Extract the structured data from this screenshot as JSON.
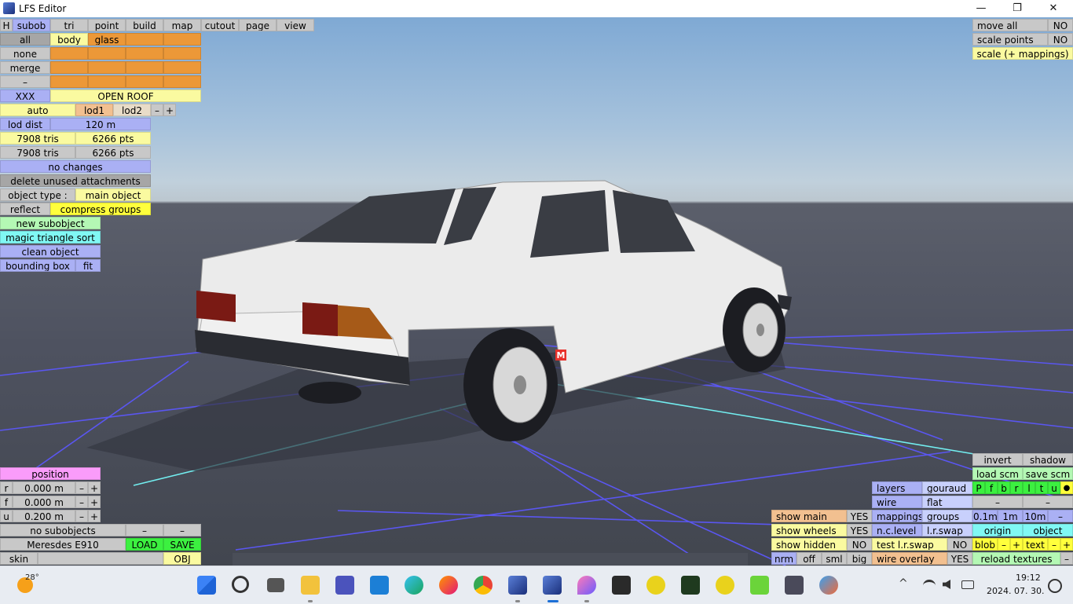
{
  "window": {
    "title": "LFS Editor",
    "min_glyph": "—",
    "max_glyph": "❐",
    "close_glyph": "✕"
  },
  "tabs": [
    "H",
    "subob",
    "tri",
    "point",
    "build",
    "map",
    "cutout",
    "page",
    "view"
  ],
  "left_panel": {
    "all": "all",
    "body": "body",
    "glass": "glass",
    "none": "none",
    "merge": "merge",
    "dash": "–",
    "xxx": "XXX",
    "open_roof": "OPEN ROOF",
    "auto": "auto",
    "lod1": "lod1",
    "lod2": "lod2",
    "minus": "–",
    "plus": "+",
    "lod_dist_label": "lod dist",
    "lod_dist_value": "120 m",
    "tris1": "7908 tris",
    "pts1": "6266 pts",
    "tris2": "7908 tris",
    "pts2": "6266 pts",
    "no_changes": "no changes",
    "delete_unused": "delete unused attachments",
    "object_type_label": "object type :",
    "object_type_value": "main object",
    "reflect": "reflect",
    "compress_groups": "compress groups",
    "new_subobject": "new subobject",
    "magic_triangle_sort": "magic triangle sort",
    "clean_object": "clean object",
    "bounding_box": "bounding box",
    "fit": "fit"
  },
  "top_right": {
    "move_all": "move all",
    "move_all_value": "NO",
    "scale_points": "scale points",
    "scale_points_value": "NO",
    "scale_mappings": "scale (+ mappings)"
  },
  "position_panel": {
    "title": "position",
    "rows": [
      {
        "axis": "r",
        "value": "0.000 m"
      },
      {
        "axis": "f",
        "value": "0.000 m"
      },
      {
        "axis": "u",
        "value": "0.200 m"
      }
    ],
    "minus": "–",
    "plus": "+",
    "no_subobjects": "no subobjects",
    "dash": "–",
    "model_name": "Meresdes E910",
    "load": "LOAD",
    "save": "SAVE",
    "skin": "skin",
    "obj": "OBJ"
  },
  "view_panel": {
    "show_main": "show main",
    "show_main_value": "YES",
    "show_wheels": "show wheels",
    "show_wheels_value": "YES",
    "show_hidden": "show hidden",
    "show_hidden_value": "NO",
    "nrm": "nrm",
    "off": "off",
    "sml": "sml",
    "big": "big",
    "layers": "layers",
    "gouraud": "gouraud",
    "wire": "wire",
    "flat": "flat",
    "mappings": "mappings",
    "groups": "groups",
    "nc_level": "n.c.level",
    "lr_swap": "l.r.swap",
    "test_lr_swap": "test l.r.swap",
    "test_lr_swap_value": "NO",
    "wire_overlay": "wire overlay",
    "wire_overlay_value": "YES",
    "invert": "invert",
    "shadow": "shadow",
    "load_scm": "load scm",
    "save_scm": "save scm",
    "letters": [
      "P",
      "f",
      "b",
      "r",
      "l",
      "t",
      "u",
      "●"
    ],
    "dash": "–",
    "grid_sizes": [
      "0.1m",
      "1m",
      "10m",
      "–"
    ],
    "origin": "origin",
    "object": "object",
    "blob": "blob",
    "text": "text",
    "minus": "–",
    "plus": "+",
    "reload_textures": "reload textures"
  },
  "scene": {
    "marker": "M"
  },
  "taskbar": {
    "weather_temp": "28°",
    "time": "19:12",
    "date": "2024. 07. 30.",
    "tray_chevron": "^",
    "apps": [
      "start-icon",
      "search-icon",
      "task-view-icon",
      "file-explorer-icon",
      "teams-icon",
      "mail-icon",
      "edge-icon",
      "firefox-icon",
      "chrome-icon",
      "lfs-icon",
      "lfs-editor-icon",
      "water-drop-icon",
      "game-avatar-icon",
      "lfs-logo-icon",
      "game-avatar2-icon",
      "lfs-logo2-icon",
      "cactus-icon",
      "game-tile-icon",
      "globe-icon"
    ]
  }
}
